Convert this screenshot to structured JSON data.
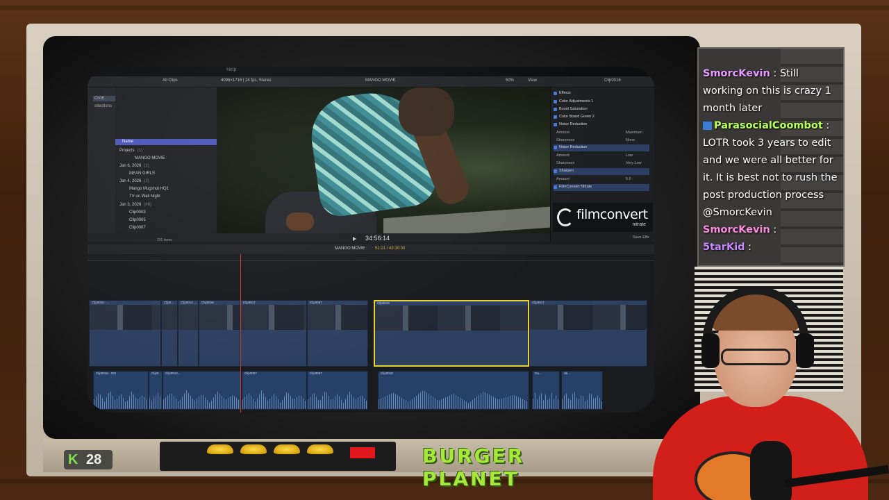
{
  "editor": {
    "menu_help": "Help",
    "toolbar": {
      "all_clips": "All Clips",
      "format": "4096×1716 | 24 fps, Stereo",
      "project_name": "MANGO MOVIE",
      "zoom": "50%",
      "view": "View",
      "clip_name": "Clip0016"
    },
    "sidebar": {
      "item1": "OVIE",
      "item2": "ollections"
    },
    "library": {
      "header": "Name",
      "items": [
        {
          "label": "Projects",
          "count": "(1)"
        },
        {
          "label": "MANGO MOVIE",
          "count": ""
        },
        {
          "label": "Jan 6, 2026",
          "count": "(1)"
        },
        {
          "label": "MEAN GIRLS",
          "count": ""
        },
        {
          "label": "Jan 4, 2026",
          "count": "(2)"
        },
        {
          "label": "Mango Mugshot HQ1",
          "count": ""
        },
        {
          "label": "TV on Wall Night",
          "count": ""
        },
        {
          "label": "Jan 3, 2026",
          "count": "(46)"
        },
        {
          "label": "Clip0003",
          "count": ""
        },
        {
          "label": "Clip0005",
          "count": ""
        },
        {
          "label": "Clip0007",
          "count": ""
        }
      ],
      "item_count": "231 items"
    },
    "viewer": {
      "timecode": "34:56:14"
    },
    "inspector": {
      "effects_label": "Effects",
      "rows": [
        {
          "label": "Color Adjustments 1",
          "value": ""
        },
        {
          "label": "Boost Saturation",
          "value": ""
        },
        {
          "label": "Color Board Green 2",
          "value": ""
        },
        {
          "label": "Noise Reduction",
          "value": ""
        }
      ],
      "nr1": {
        "amount_label": "Amount",
        "amount": "Maximum",
        "sharp_label": "Sharpness",
        "sharp": "None"
      },
      "nr2_label": "Noise Reduction",
      "nr2": {
        "amount_label": "Amount",
        "amount": "Low",
        "sharp_label": "Sharpness",
        "sharp": "Very Low"
      },
      "sharpen_label": "Sharpen",
      "sharpen": {
        "amount_label": "Amount",
        "amount": "5.0"
      },
      "filmconvert_label": "FilmConvert Nitrate",
      "save_effects": "Save Effe"
    },
    "filmconvert": {
      "name": "filmconvert",
      "sub": "nitrate"
    },
    "timeline": {
      "title": "MANGO MOVIE",
      "duration": "51:21 / 43:30:00",
      "clips": [
        "Clip0016 - ...",
        "Clip0...",
        "Clip0014 ...",
        "Clip0016",
        "Clip0017",
        "Clip0057",
        "Clip0019",
        "Clip0017"
      ],
      "audio_clips": [
        "Clip0016 - 021",
        "Clip0...",
        "Clip0014...",
        "Clip0057",
        "Clip0057",
        "Clip0019",
        "Ou...",
        "Sti..."
      ]
    }
  },
  "overlay": {
    "k_label": "K",
    "k_count": "28",
    "brand_title": "BURGER PLANET"
  },
  "chat": [
    {
      "user": "SmorcKevin",
      "sep": " : ",
      "text": "Still working on this is crazy 1 month later"
    },
    {
      "user": "ParasocialCoombot",
      "sep": " : ",
      "text": "LOTR took 3 years to edit and we were all better for it. It is best not to rush the post production process @SmorcKevin"
    },
    {
      "user": "SmorcKevin",
      "sep": " : ",
      "text": ""
    },
    {
      "user": "5tarKid",
      "sep": " : ",
      "text": ""
    }
  ]
}
